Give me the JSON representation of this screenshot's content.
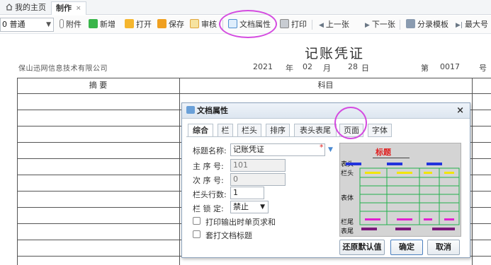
{
  "tabs": {
    "home_label": "我的主页",
    "active_label": "制作",
    "close_glyph": "×"
  },
  "toolbar": {
    "type_select": "0 普通",
    "attach": "附件",
    "new": "新增",
    "open": "打开",
    "save": "保存",
    "review": "审核",
    "doc_props": "文档属性",
    "print": "打印",
    "prev": "上一张",
    "next": "下一张",
    "split_template": "分录模板",
    "max_no": "最大号"
  },
  "voucher": {
    "title": "记账凭证",
    "company": "保山迅网信息技术有限公司",
    "year": "2021",
    "year_unit": "年",
    "month": "02",
    "month_unit": "月",
    "day": "28",
    "day_unit": "日",
    "number_prefix": "第",
    "number": "0017",
    "number_unit": "号",
    "col_summary": "摘  要",
    "col_subject": "科目"
  },
  "dialog": {
    "title": "文档属性",
    "close": "×",
    "tabs": [
      "综合",
      "栏",
      "栏头",
      "排序",
      "表头表尾",
      "页面",
      "字体"
    ],
    "active_tab": "综合",
    "fields": {
      "title_name_label": "标题名称:",
      "title_name_value": "记账凭证",
      "main_seq_label": "主 序 号:",
      "main_seq_value": "101",
      "sub_seq_label": "次 序 号:",
      "sub_seq_value": "0",
      "header_rows_label": "栏头行数:",
      "header_rows_value": "1",
      "lock_label": "栏 锁 定:",
      "lock_value": "禁止"
    },
    "checkbox_print_sum": "打印输出时单页求和",
    "checkbox_overlay_title": "套打文档标题",
    "preview": {
      "title": "标题",
      "biaotou": "表头",
      "lantou": "栏头",
      "biaoti": "表体",
      "lanwei": "栏尾",
      "biaowei": "表尾"
    },
    "buttons": {
      "restore": "还原默认值",
      "ok": "确定",
      "cancel": "取消"
    }
  },
  "colors": {
    "annotation": "#d44be0",
    "preview_blue": "#2233dd",
    "preview_yellow": "#f2e600",
    "preview_magenta": "#e020d0",
    "preview_purple": "#7a1a7a",
    "preview_grid": "#22b14c",
    "preview_title": "#e02020"
  }
}
